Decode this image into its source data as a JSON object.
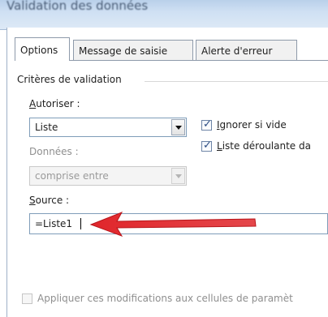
{
  "window": {
    "title": "Validation des données"
  },
  "tabs": [
    {
      "label": "Options",
      "active": true
    },
    {
      "label": "Message de saisie",
      "active": false
    },
    {
      "label": "Alerte d'erreur",
      "active": false
    }
  ],
  "criteria": {
    "group_label": "Critères de validation",
    "allow": {
      "label_mnemonic": "A",
      "label_rest": "utoriser :",
      "value": "Liste"
    },
    "data": {
      "label": "Données :",
      "value": "comprise entre"
    },
    "source": {
      "label_mnemonic": "S",
      "label_rest": "ource :",
      "value": "=Liste1"
    },
    "ignore_blank": {
      "label_mnemonic": "I",
      "label_rest": "gnorer si vide",
      "checked": true
    },
    "in_cell_dropdown": {
      "label_mnemonic": "L",
      "label_rest": "iste déroulante da",
      "checked": true
    }
  },
  "apply_all": {
    "label": "Appliquer ces modifications aux cellules de paramèt",
    "checked": false
  },
  "colors": {
    "arrow": "#e0262b",
    "accent": "#2c4c82"
  }
}
